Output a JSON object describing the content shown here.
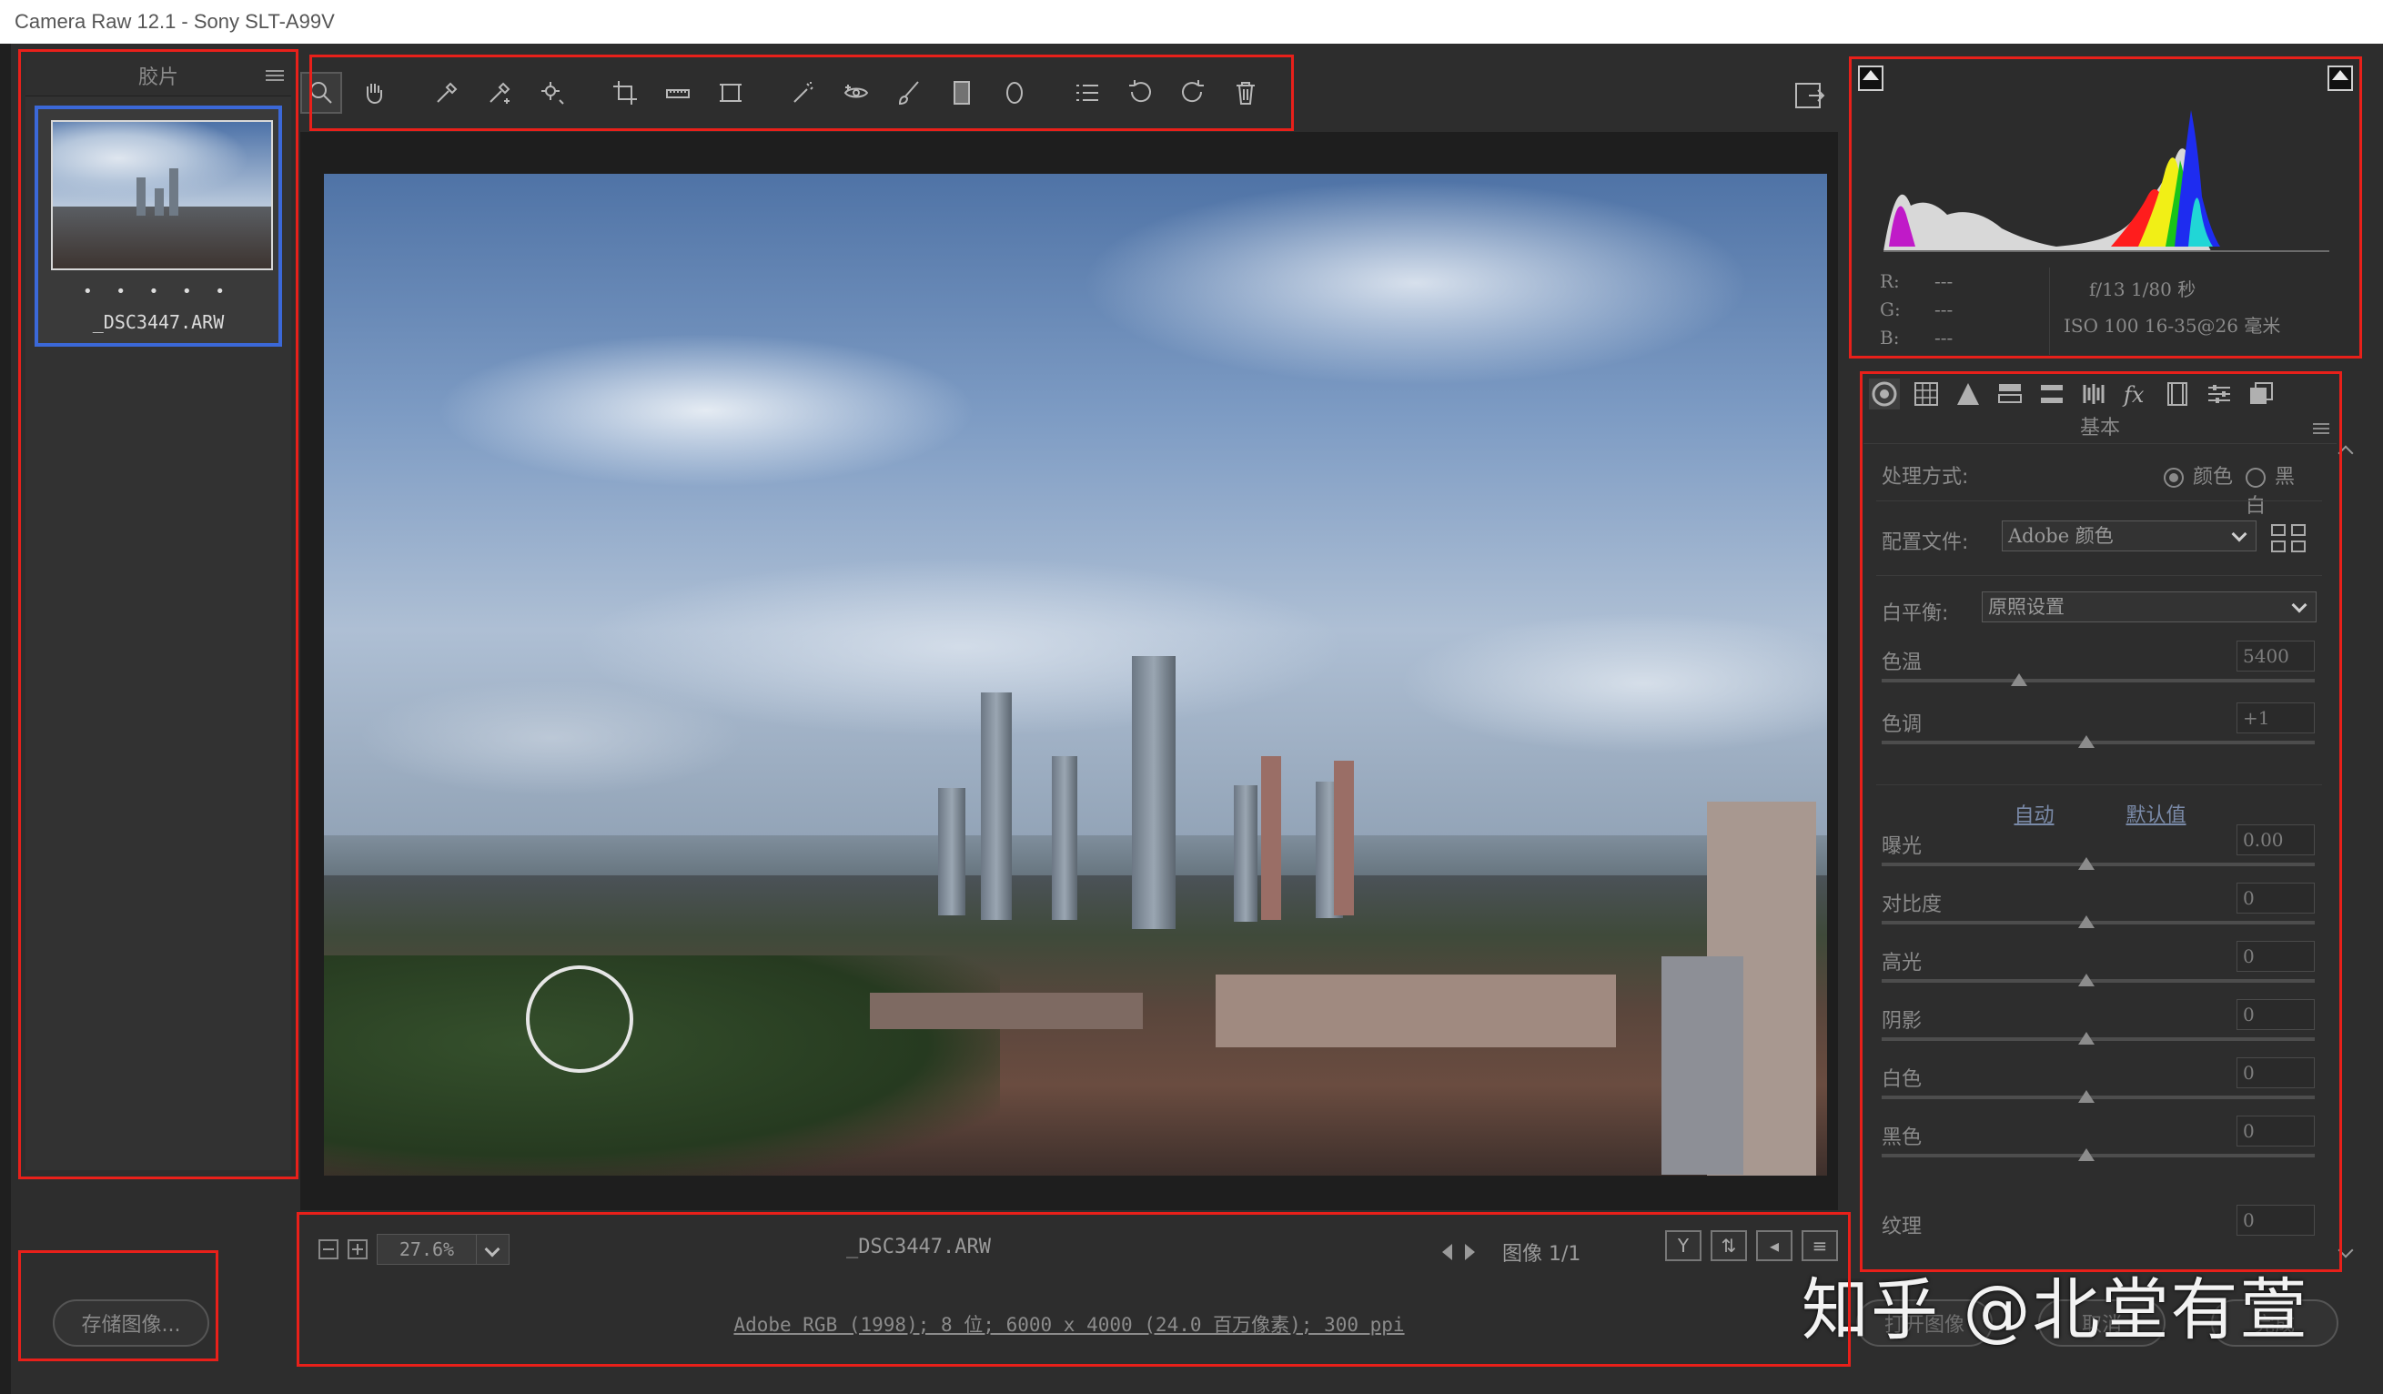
{
  "window": {
    "title": "Camera Raw 12.1 -  Sony SLT-A99V"
  },
  "filmstrip": {
    "title": "胶片",
    "thumbnail": {
      "filename": "_DSC3447.ARW",
      "rating_dots": "• • • • •"
    }
  },
  "toolbar": {
    "tools": [
      "zoom-icon",
      "hand-icon",
      "white-balance-icon",
      "color-sampler-icon",
      "targeted-adjustment-icon",
      "crop-icon",
      "straighten-icon",
      "transform-icon",
      "spot-removal-icon",
      "red-eye-icon",
      "adjustment-brush-icon",
      "graduated-filter-icon",
      "radial-filter-icon",
      "preferences-icon",
      "rotate-ccw-icon",
      "rotate-cw-icon",
      "delete-icon"
    ]
  },
  "preview": {
    "zoom": "27.6%",
    "filename": "_DSC3447.ARW",
    "image_count": "图像 1/1",
    "info": "Adobe RGB (1998); 8 位; 6000 x 4000 (24.0 百万像素); 300 ppi"
  },
  "buttons": {
    "save": "存储图像...",
    "open": "打开图像",
    "cancel": "取消",
    "done": "完成"
  },
  "histogram": {
    "r_label": "R:",
    "g_label": "G:",
    "b_label": "B:",
    "r": "---",
    "g": "---",
    "b": "---",
    "exif_line1": "f/13  1/80 秒",
    "exif_line2": "ISO 100  16-35@26 毫米"
  },
  "panel": {
    "title": "基本",
    "treatment_label": "处理方式:",
    "treatment_color": "颜色",
    "treatment_bw": "黑白",
    "profile_label": "配置文件:",
    "profile_value": "Adobe 颜色",
    "wb_label": "白平衡:",
    "wb_value": "原照设置",
    "auto": "自动",
    "default": "默认值",
    "sliders": [
      {
        "label": "色温",
        "value": "5400"
      },
      {
        "label": "色调",
        "value": "+1"
      },
      {
        "label": "曝光",
        "value": "0.00"
      },
      {
        "label": "对比度",
        "value": "0"
      },
      {
        "label": "高光",
        "value": "0"
      },
      {
        "label": "阴影",
        "value": "0"
      },
      {
        "label": "白色",
        "value": "0"
      },
      {
        "label": "黑色",
        "value": "0"
      },
      {
        "label": "纹理",
        "value": "0"
      }
    ]
  },
  "watermark": "知乎 @北堂有萱",
  "colors": {
    "highlight_box": "#e8201a",
    "selection": "#3b68d8",
    "background": "#2d2d2d"
  }
}
